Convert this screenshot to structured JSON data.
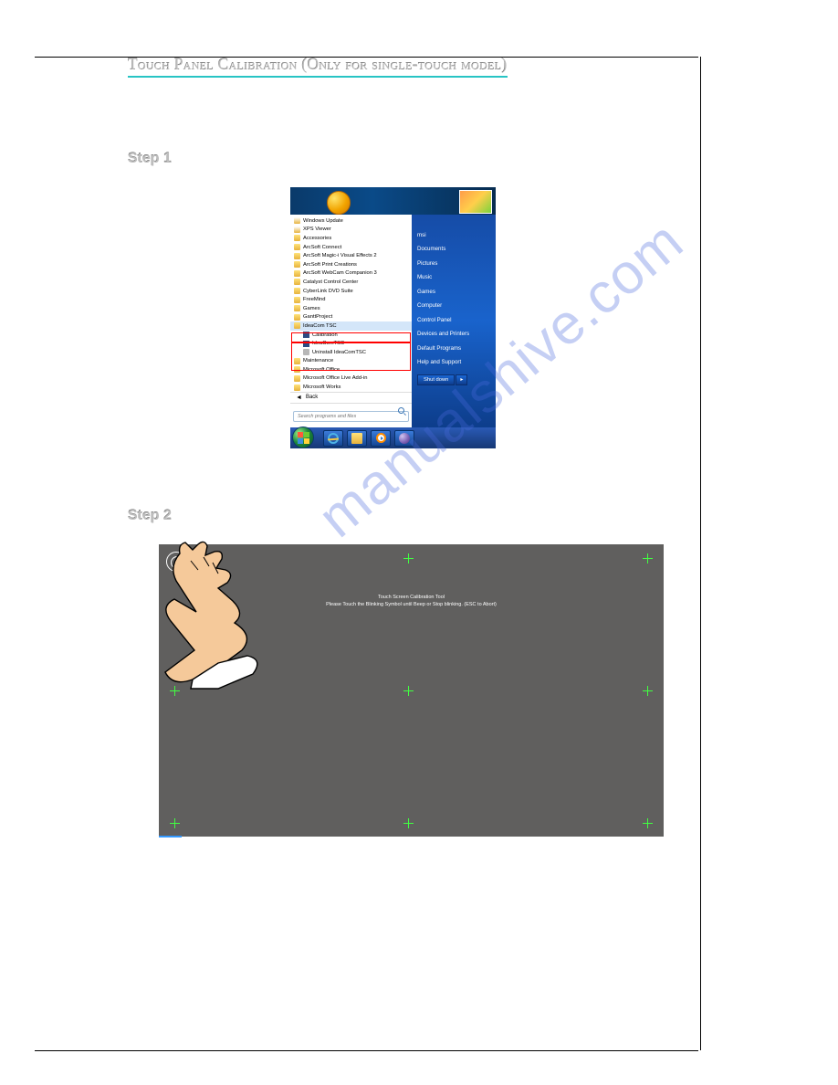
{
  "title": "Touch Panel Calibration (Only for single-touch model)",
  "steps": {
    "one": "Step 1",
    "two": "Step 2"
  },
  "watermark": "manualshive.com",
  "start_menu": {
    "left": [
      {
        "icon": "app",
        "label": "Windows Update"
      },
      {
        "icon": "app",
        "label": "XPS Viewer"
      },
      {
        "icon": "folder",
        "label": "Accessories"
      },
      {
        "icon": "folder",
        "label": "ArcSoft Connect"
      },
      {
        "icon": "folder",
        "label": "ArcSoft Magic-i Visual Effects 2"
      },
      {
        "icon": "folder",
        "label": "ArcSoft Print Creations"
      },
      {
        "icon": "folder",
        "label": "ArcSoft WebCam Companion 3"
      },
      {
        "icon": "folder",
        "label": "Catalyst Control Center"
      },
      {
        "icon": "folder",
        "label": "CyberLink DVD Suite"
      },
      {
        "icon": "folder",
        "label": "FreeMind"
      },
      {
        "icon": "folder",
        "label": "Games"
      },
      {
        "icon": "folder",
        "label": "GanttProject"
      },
      {
        "icon": "folder",
        "label": "IdeaCom TSC",
        "selected": true
      },
      {
        "icon": "blue",
        "label": "Calibration",
        "sub": true
      },
      {
        "icon": "blue",
        "label": "IdeaComTSC",
        "sub": true
      },
      {
        "icon": "grey",
        "label": "Uninstall IdeaComTSC",
        "sub": true
      },
      {
        "icon": "folder",
        "label": "Maintenance"
      },
      {
        "icon": "folder",
        "label": "Microsoft Office"
      },
      {
        "icon": "folder",
        "label": "Microsoft Office Live Add-in"
      },
      {
        "icon": "folder",
        "label": "Microsoft Works"
      }
    ],
    "back": "Back",
    "search_placeholder": "Search programs and files",
    "right": [
      "msi",
      "Documents",
      "Pictures",
      "Music",
      "Games",
      "Computer",
      "Control Panel",
      "Devices and Printers",
      "Default Programs",
      "Help and Support"
    ],
    "shutdown": "Shut down"
  },
  "calibration": {
    "line1": "Touch Screen Calibration Tool",
    "line2": "Please Touch the Blinking Symbol until Beep or Stop blinking. (ESC to Abort)"
  }
}
